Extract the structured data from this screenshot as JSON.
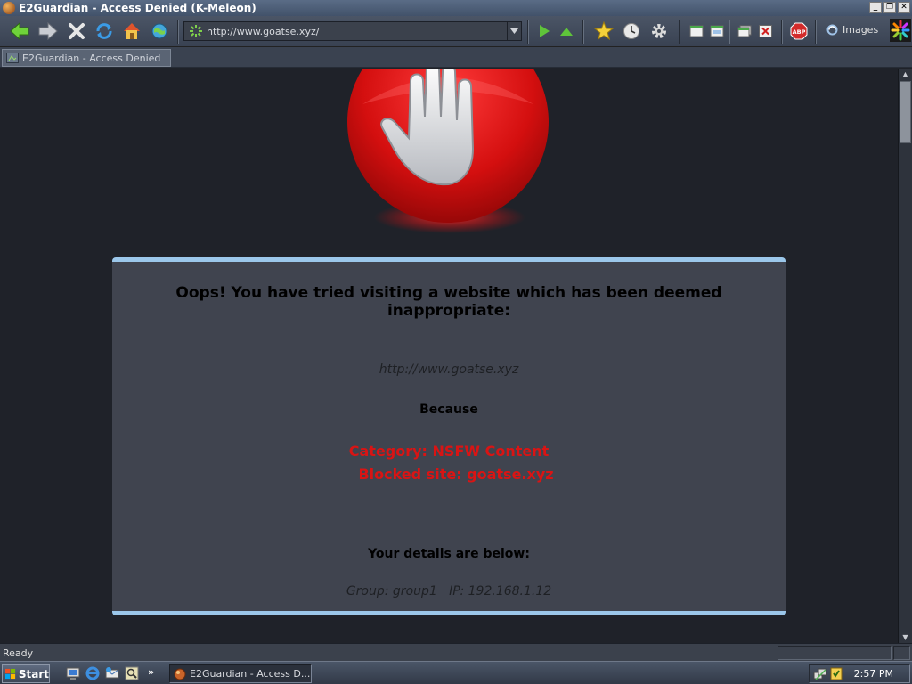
{
  "window": {
    "title": "E2Guardian - Access Denied (K-Meleon)"
  },
  "toolbar": {
    "url": "http://www.goatse.xyz/",
    "images_label": "Images"
  },
  "tabs": [
    {
      "label": "E2Guardian - Access Denied"
    }
  ],
  "page": {
    "headline": "Oops! You have tried visiting a website which has been deemed inappropriate:",
    "blocked_url": "http://www.goatse.xyz",
    "because_label": "Because",
    "category_line": "Category: NSFW Content",
    "blocked_site_line": "Blocked site: goatse.xyz",
    "details_heading": "Your details are below:",
    "details_line": "Group: group1   IP: 192.168.1.12"
  },
  "status": {
    "text": "Ready"
  },
  "taskbar": {
    "start_label": "Start",
    "task_label": "E2Guardian - Access D...",
    "clock": "2:57 PM"
  },
  "colors": {
    "accent_border": "#9bc7ea",
    "reason_red": "#d91414",
    "page_bg": "#1f2229",
    "panel_bg": "#40444f"
  }
}
